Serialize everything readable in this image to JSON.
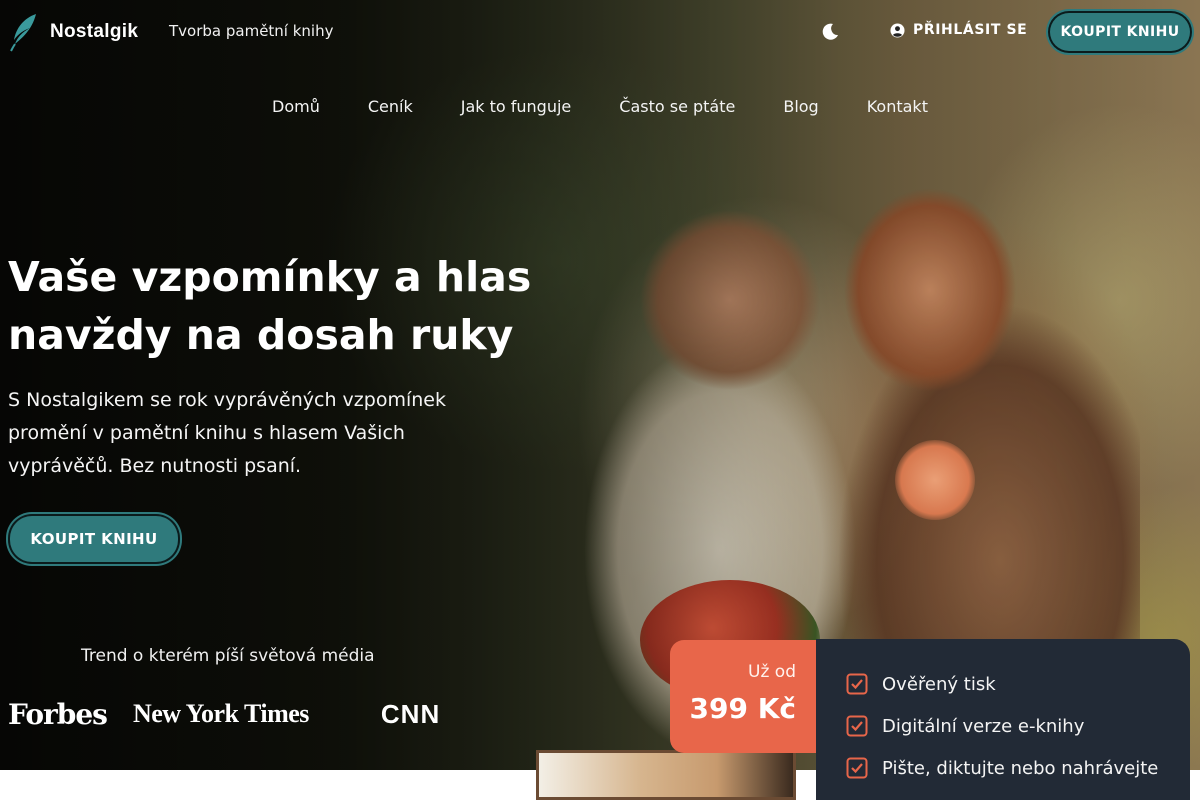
{
  "brand": {
    "name": "Nostalgik",
    "tagline": "Tvorba pamětní knihy"
  },
  "header": {
    "theme_toggle_icon": "moon-icon",
    "login_label": "PŘIHLÁSIT SE",
    "login_icon": "user-circle-icon",
    "cta_label": "KOUPIT KNIHU"
  },
  "nav": {
    "items": [
      {
        "label": "Domů"
      },
      {
        "label": "Ceník"
      },
      {
        "label": "Jak to funguje"
      },
      {
        "label": "Často se ptáte"
      },
      {
        "label": "Blog"
      },
      {
        "label": "Kontakt"
      }
    ]
  },
  "hero": {
    "title": "Vaše vzpomínky a hlas navždy na dosah ruky",
    "subtitle": "S Nostalgikem se rok vyprávěných vzpomínek promění v pamětní knihu s hlasem Vašich vyprávěčů. Bez nutnosti psaní.",
    "cta_label": "KOUPIT KNIHU"
  },
  "media": {
    "title": "Trend o kterém píší světová média",
    "logos": [
      "Forbes",
      "New York Times",
      "CNN"
    ]
  },
  "pricing": {
    "from_label": "Už od",
    "price": "399 Kč",
    "features": [
      "Ověřený tisk",
      "Digitální verze e-knihy",
      "Pište, diktujte nebo nahrávejte"
    ]
  },
  "colors": {
    "accent_teal": "#2f7a7c",
    "price_orange": "#e8664a",
    "card_dark": "#222a36"
  }
}
